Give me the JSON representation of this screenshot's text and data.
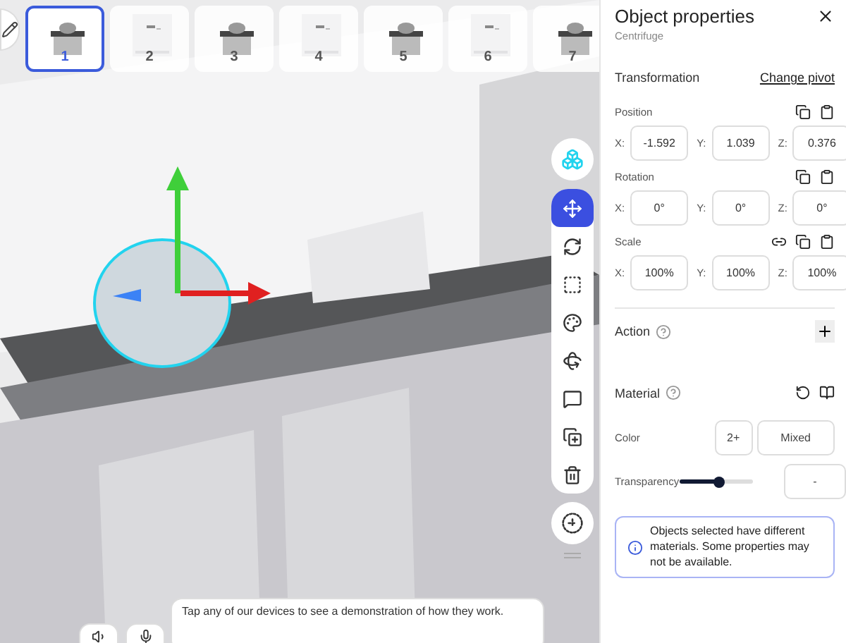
{
  "thumbnails": [
    {
      "label": "1",
      "selected": true
    },
    {
      "label": "2",
      "selected": false
    },
    {
      "label": "3",
      "selected": false
    },
    {
      "label": "4",
      "selected": false
    },
    {
      "label": "5",
      "selected": false
    },
    {
      "label": "6",
      "selected": false
    },
    {
      "label": "7",
      "selected": false
    }
  ],
  "toolbar": {
    "tools": [
      {
        "selected": true
      },
      {
        "selected": false
      },
      {
        "selected": false
      },
      {
        "selected": false
      },
      {
        "selected": false
      },
      {
        "selected": false
      },
      {
        "selected": false
      },
      {
        "selected": false
      }
    ]
  },
  "caption": "Tap any of our devices to see a demonstration of how they work.",
  "panel": {
    "title": "Object properties",
    "subtitle": "Centrifuge",
    "transformation": {
      "title": "Transformation",
      "link": "Change pivot",
      "groups": [
        {
          "label": "Position",
          "linked": false,
          "fields": [
            {
              "axis": "X:",
              "value": "-1.592"
            },
            {
              "axis": "Y:",
              "value": "1.039"
            },
            {
              "axis": "Z:",
              "value": "0.376"
            }
          ]
        },
        {
          "label": "Rotation",
          "linked": false,
          "fields": [
            {
              "axis": "X:",
              "value": "0°"
            },
            {
              "axis": "Y:",
              "value": "0°"
            },
            {
              "axis": "Z:",
              "value": "0°"
            }
          ]
        },
        {
          "label": "Scale",
          "linked": true,
          "fields": [
            {
              "axis": "X:",
              "value": "100%"
            },
            {
              "axis": "Y:",
              "value": "100%"
            },
            {
              "axis": "Z:",
              "value": "100%"
            }
          ]
        }
      ]
    },
    "action": {
      "title": "Action"
    },
    "material": {
      "title": "Material",
      "color_label": "Color",
      "color_count": "2+",
      "color_value": "Mixed",
      "transparency_label": "Transparency",
      "transparency": {
        "level": 0.55
      },
      "transparency_value": "-"
    },
    "note": "Objects selected have different materials. Some properties may not be available."
  }
}
